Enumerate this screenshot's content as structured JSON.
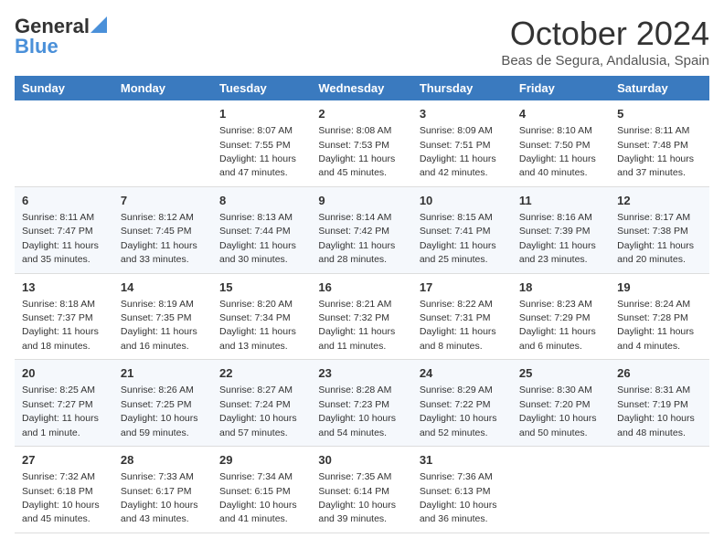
{
  "header": {
    "logo_general": "General",
    "logo_blue": "Blue",
    "month_title": "October 2024",
    "location": "Beas de Segura, Andalusia, Spain"
  },
  "days_of_week": [
    "Sunday",
    "Monday",
    "Tuesday",
    "Wednesday",
    "Thursday",
    "Friday",
    "Saturday"
  ],
  "weeks": [
    [
      {
        "day": "",
        "info": ""
      },
      {
        "day": "",
        "info": ""
      },
      {
        "day": "1",
        "info": "Sunrise: 8:07 AM\nSunset: 7:55 PM\nDaylight: 11 hours and 47 minutes."
      },
      {
        "day": "2",
        "info": "Sunrise: 8:08 AM\nSunset: 7:53 PM\nDaylight: 11 hours and 45 minutes."
      },
      {
        "day": "3",
        "info": "Sunrise: 8:09 AM\nSunset: 7:51 PM\nDaylight: 11 hours and 42 minutes."
      },
      {
        "day": "4",
        "info": "Sunrise: 8:10 AM\nSunset: 7:50 PM\nDaylight: 11 hours and 40 minutes."
      },
      {
        "day": "5",
        "info": "Sunrise: 8:11 AM\nSunset: 7:48 PM\nDaylight: 11 hours and 37 minutes."
      }
    ],
    [
      {
        "day": "6",
        "info": "Sunrise: 8:11 AM\nSunset: 7:47 PM\nDaylight: 11 hours and 35 minutes."
      },
      {
        "day": "7",
        "info": "Sunrise: 8:12 AM\nSunset: 7:45 PM\nDaylight: 11 hours and 33 minutes."
      },
      {
        "day": "8",
        "info": "Sunrise: 8:13 AM\nSunset: 7:44 PM\nDaylight: 11 hours and 30 minutes."
      },
      {
        "day": "9",
        "info": "Sunrise: 8:14 AM\nSunset: 7:42 PM\nDaylight: 11 hours and 28 minutes."
      },
      {
        "day": "10",
        "info": "Sunrise: 8:15 AM\nSunset: 7:41 PM\nDaylight: 11 hours and 25 minutes."
      },
      {
        "day": "11",
        "info": "Sunrise: 8:16 AM\nSunset: 7:39 PM\nDaylight: 11 hours and 23 minutes."
      },
      {
        "day": "12",
        "info": "Sunrise: 8:17 AM\nSunset: 7:38 PM\nDaylight: 11 hours and 20 minutes."
      }
    ],
    [
      {
        "day": "13",
        "info": "Sunrise: 8:18 AM\nSunset: 7:37 PM\nDaylight: 11 hours and 18 minutes."
      },
      {
        "day": "14",
        "info": "Sunrise: 8:19 AM\nSunset: 7:35 PM\nDaylight: 11 hours and 16 minutes."
      },
      {
        "day": "15",
        "info": "Sunrise: 8:20 AM\nSunset: 7:34 PM\nDaylight: 11 hours and 13 minutes."
      },
      {
        "day": "16",
        "info": "Sunrise: 8:21 AM\nSunset: 7:32 PM\nDaylight: 11 hours and 11 minutes."
      },
      {
        "day": "17",
        "info": "Sunrise: 8:22 AM\nSunset: 7:31 PM\nDaylight: 11 hours and 8 minutes."
      },
      {
        "day": "18",
        "info": "Sunrise: 8:23 AM\nSunset: 7:29 PM\nDaylight: 11 hours and 6 minutes."
      },
      {
        "day": "19",
        "info": "Sunrise: 8:24 AM\nSunset: 7:28 PM\nDaylight: 11 hours and 4 minutes."
      }
    ],
    [
      {
        "day": "20",
        "info": "Sunrise: 8:25 AM\nSunset: 7:27 PM\nDaylight: 11 hours and 1 minute."
      },
      {
        "day": "21",
        "info": "Sunrise: 8:26 AM\nSunset: 7:25 PM\nDaylight: 10 hours and 59 minutes."
      },
      {
        "day": "22",
        "info": "Sunrise: 8:27 AM\nSunset: 7:24 PM\nDaylight: 10 hours and 57 minutes."
      },
      {
        "day": "23",
        "info": "Sunrise: 8:28 AM\nSunset: 7:23 PM\nDaylight: 10 hours and 54 minutes."
      },
      {
        "day": "24",
        "info": "Sunrise: 8:29 AM\nSunset: 7:22 PM\nDaylight: 10 hours and 52 minutes."
      },
      {
        "day": "25",
        "info": "Sunrise: 8:30 AM\nSunset: 7:20 PM\nDaylight: 10 hours and 50 minutes."
      },
      {
        "day": "26",
        "info": "Sunrise: 8:31 AM\nSunset: 7:19 PM\nDaylight: 10 hours and 48 minutes."
      }
    ],
    [
      {
        "day": "27",
        "info": "Sunrise: 7:32 AM\nSunset: 6:18 PM\nDaylight: 10 hours and 45 minutes."
      },
      {
        "day": "28",
        "info": "Sunrise: 7:33 AM\nSunset: 6:17 PM\nDaylight: 10 hours and 43 minutes."
      },
      {
        "day": "29",
        "info": "Sunrise: 7:34 AM\nSunset: 6:15 PM\nDaylight: 10 hours and 41 minutes."
      },
      {
        "day": "30",
        "info": "Sunrise: 7:35 AM\nSunset: 6:14 PM\nDaylight: 10 hours and 39 minutes."
      },
      {
        "day": "31",
        "info": "Sunrise: 7:36 AM\nSunset: 6:13 PM\nDaylight: 10 hours and 36 minutes."
      },
      {
        "day": "",
        "info": ""
      },
      {
        "day": "",
        "info": ""
      }
    ]
  ]
}
